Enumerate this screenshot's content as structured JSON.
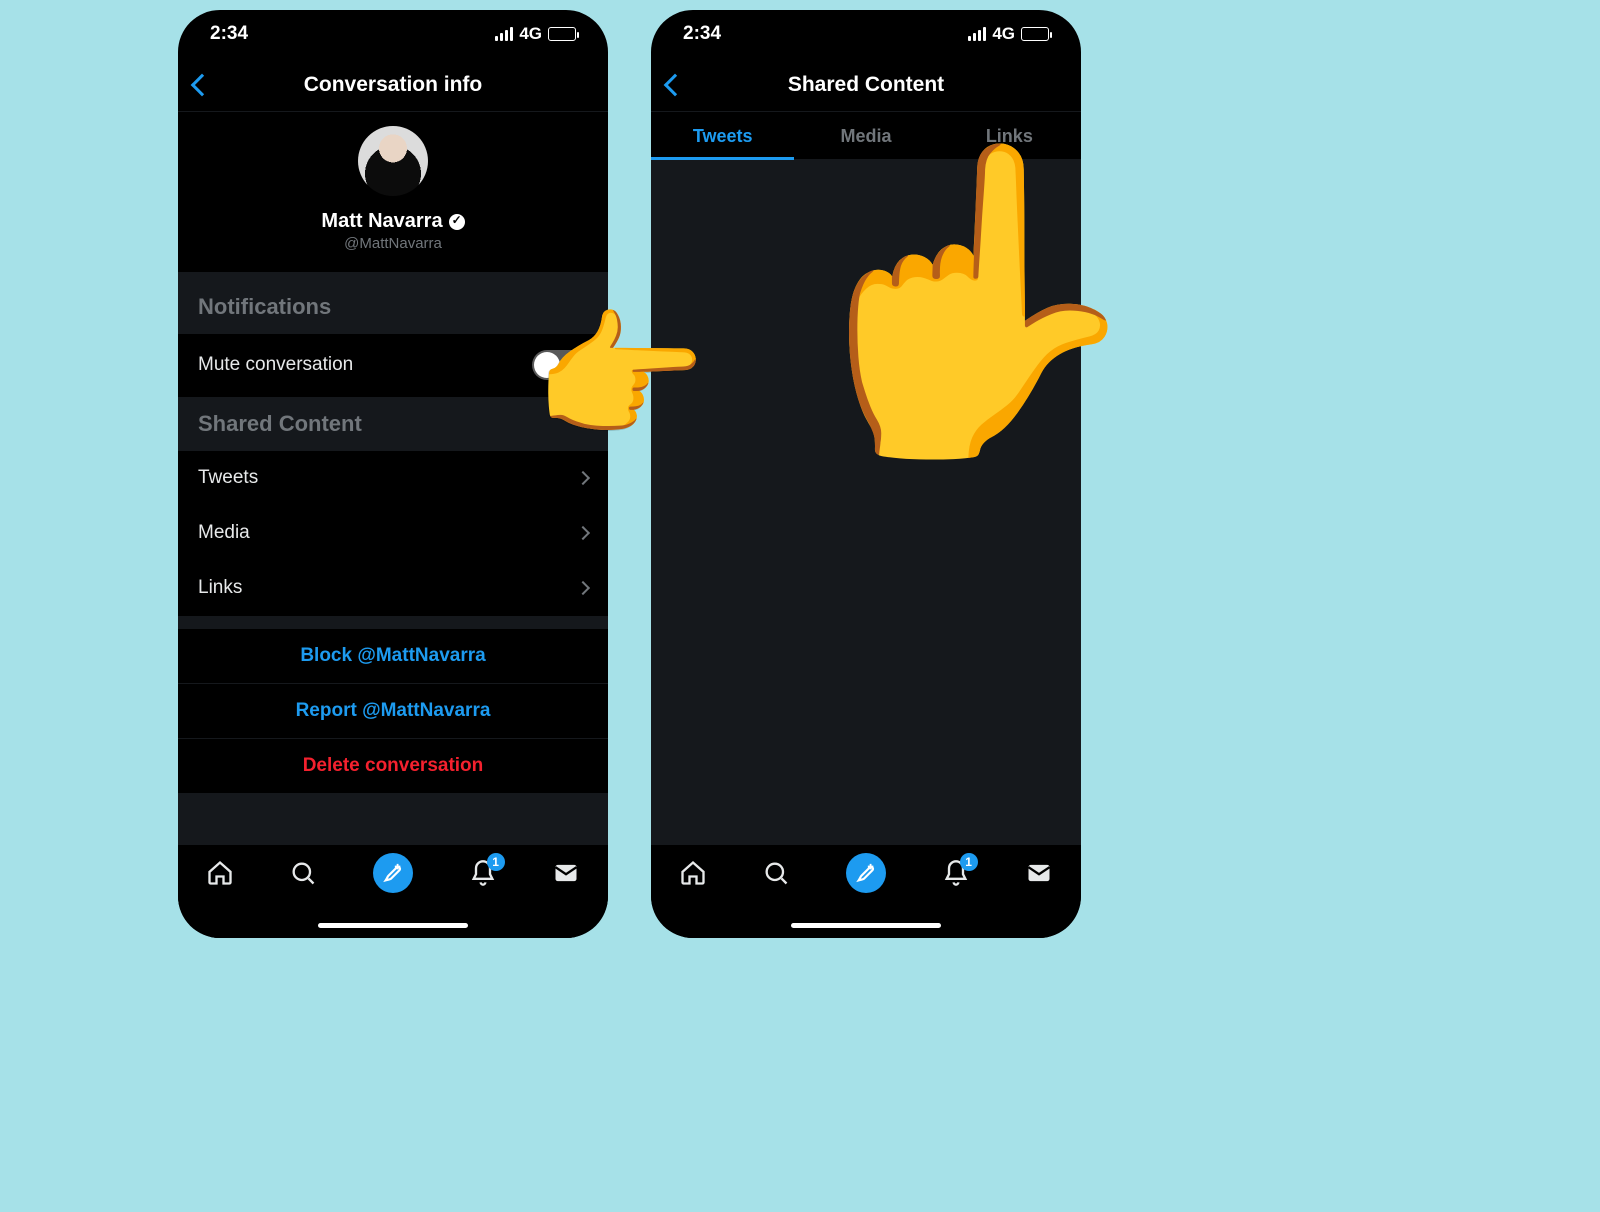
{
  "statusbar": {
    "time": "2:34",
    "network": "4G"
  },
  "left": {
    "header_title": "Conversation info",
    "user": {
      "display_name": "Matt Navarra",
      "handle": "@MattNavarra"
    },
    "sections": {
      "notifications_header": "Notifications",
      "mute_label": "Mute conversation",
      "shared_content_header": "Shared Content",
      "items": {
        "tweets": "Tweets",
        "media": "Media",
        "links": "Links"
      }
    },
    "actions": {
      "block": "Block @MattNavarra",
      "report": "Report @MattNavarra",
      "delete": "Delete conversation"
    }
  },
  "right": {
    "header_title": "Shared Content",
    "tabs": {
      "tweets": "Tweets",
      "media": "Media",
      "links": "Links"
    }
  },
  "tabbar": {
    "notification_badge": "1"
  }
}
